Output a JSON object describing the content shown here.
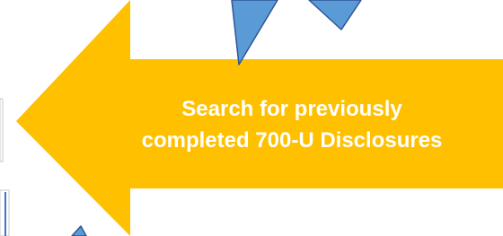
{
  "callout": {
    "line1": "Search for previously",
    "line2": "completed 700-U Disclosures"
  },
  "colors": {
    "arrow_fill": "#FFC000",
    "pointer_fill": "#5B9BD5",
    "pointer_stroke": "#2F5597",
    "text": "#FFFFFF",
    "left_edge_lines": "#4472C4"
  },
  "shapes": {
    "main_arrow": "left-pointing block arrow",
    "pointers": [
      "blue triangle pointer (top-center)",
      "blue triangle pointer (top-right)",
      "blue triangle pointer (bottom-left, partial)"
    ]
  }
}
